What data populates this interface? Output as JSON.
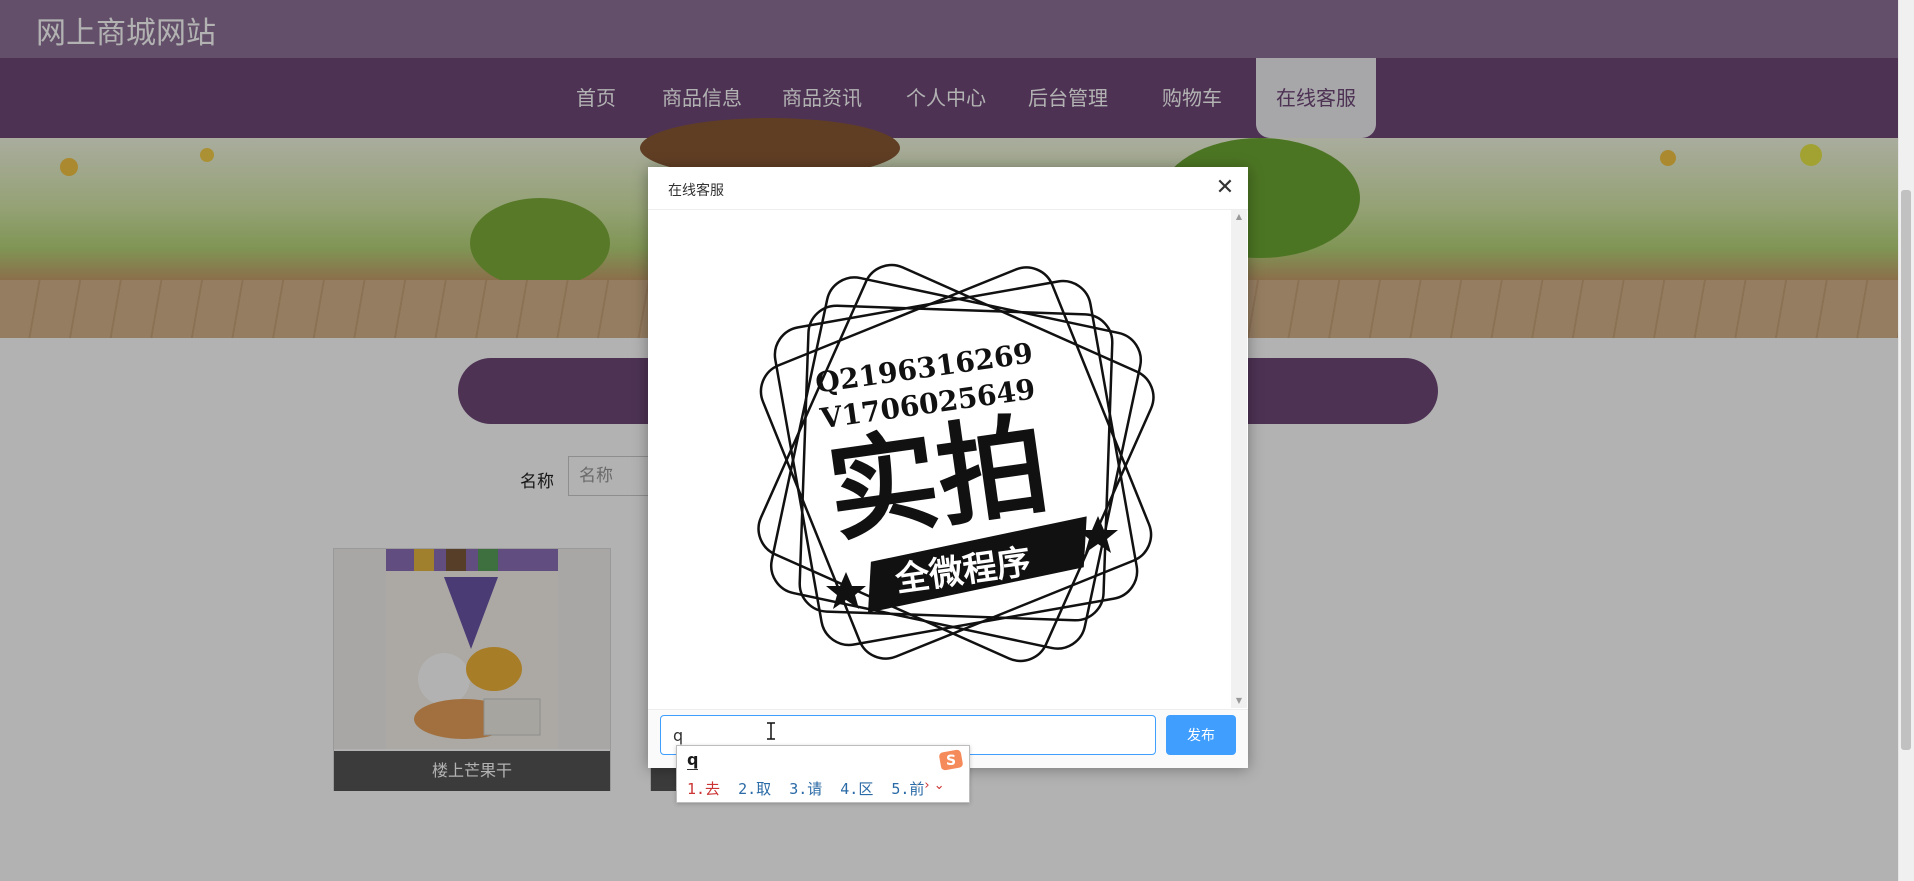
{
  "site": {
    "title": "网上商城网站"
  },
  "nav": {
    "items": [
      {
        "label": "首页"
      },
      {
        "label": "商品信息"
      },
      {
        "label": "商品资讯"
      },
      {
        "label": "个人中心"
      },
      {
        "label": "后台管理"
      },
      {
        "label": "购物车"
      },
      {
        "label": "在线客服",
        "active": true
      }
    ]
  },
  "search": {
    "label": "名称",
    "placeholder": "名称"
  },
  "products": [
    {
      "name": "楼上芒果干"
    }
  ],
  "modal": {
    "title": "在线客服",
    "close_icon": "close-icon",
    "sticker": {
      "line1": "Q2196316269",
      "line2": "V1706025649",
      "big": "实拍",
      "ribbon": "全微程序"
    },
    "input_value": "q",
    "send_label": "发布"
  },
  "ime": {
    "composition": "q",
    "candidates": [
      "1.去",
      "2.取",
      "3.请",
      "4.区",
      "5.前"
    ]
  },
  "colors": {
    "nav_bg": "#6f4879",
    "topbar_bg": "#8e7197",
    "accent": "#409eff"
  }
}
